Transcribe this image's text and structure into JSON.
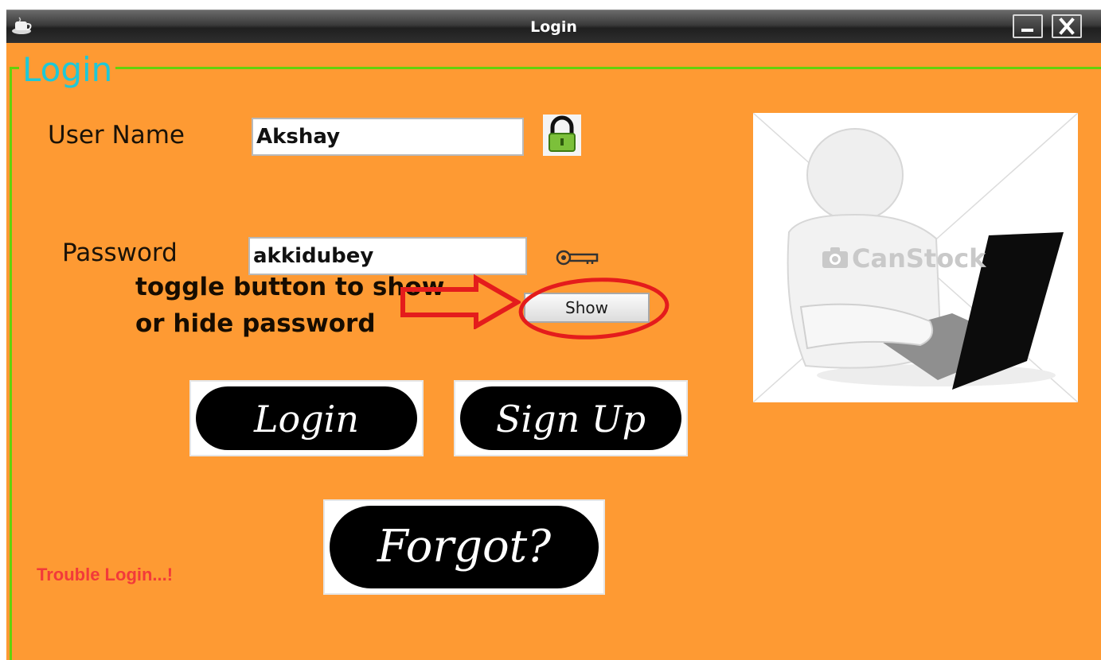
{
  "window": {
    "title": "Login"
  },
  "form": {
    "group_title": "Login",
    "username_label": "User Name",
    "username_value": "Akshay",
    "password_label": "Password",
    "password_value": "akkidubey",
    "show_button": "Show",
    "annotation_line1": "toggle button to show",
    "annotation_line2": "or hide password",
    "login_button": "Login",
    "signup_button": "Sign Up",
    "forgot_button": "Forgot?",
    "trouble_text": "Trouble Login...!"
  },
  "photo": {
    "watermark": "CanStock"
  },
  "icons": {
    "app": "coffee-cup-icon",
    "username": "padlock-icon",
    "password": "key-icon",
    "minimize": "minimize-icon",
    "close": "close-icon"
  },
  "colors": {
    "background": "#fe9a33",
    "group_border": "#64d20a",
    "group_title": "#1ec8d7",
    "trouble_text": "#f23a3a",
    "annotation_red": "#e41c1c",
    "button_fill": "#000000"
  }
}
